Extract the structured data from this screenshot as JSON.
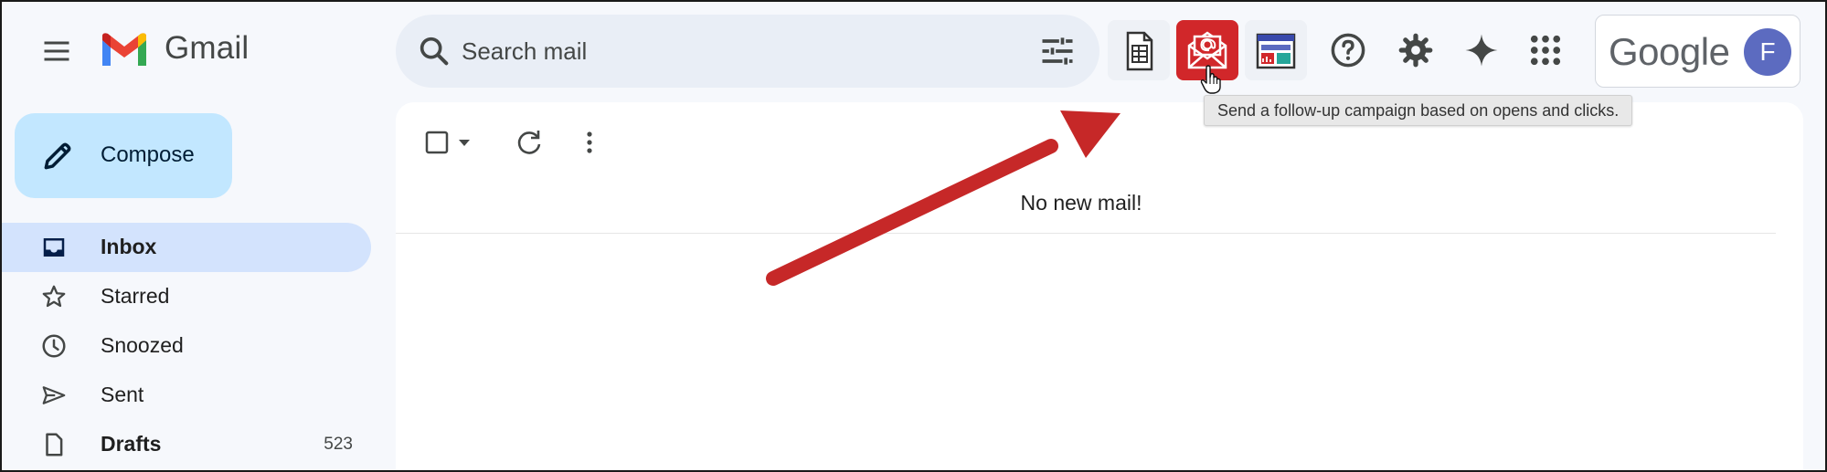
{
  "app": {
    "name": "Gmail"
  },
  "search": {
    "placeholder": "Search mail"
  },
  "header_tools": [
    {
      "name": "spreadsheet-addon-icon"
    },
    {
      "name": "follow-up-campaign-icon"
    },
    {
      "name": "dashboard-addon-icon"
    },
    {
      "name": "help-icon"
    },
    {
      "name": "settings-gear-icon"
    },
    {
      "name": "gemini-spark-icon"
    },
    {
      "name": "apps-grid-icon"
    }
  ],
  "account": {
    "brand": "Google",
    "avatar_letter": "F"
  },
  "tooltip": {
    "text": "Send a follow-up campaign based on opens and clicks."
  },
  "compose": {
    "label": "Compose"
  },
  "nav": [
    {
      "label": "Inbox",
      "icon": "inbox-icon",
      "active": true,
      "bold": true,
      "count": ""
    },
    {
      "label": "Starred",
      "icon": "star-icon",
      "active": false,
      "bold": false,
      "count": ""
    },
    {
      "label": "Snoozed",
      "icon": "clock-icon",
      "active": false,
      "bold": false,
      "count": ""
    },
    {
      "label": "Sent",
      "icon": "send-icon",
      "active": false,
      "bold": false,
      "count": ""
    },
    {
      "label": "Drafts",
      "icon": "draft-icon",
      "active": false,
      "bold": true,
      "count": "523"
    }
  ],
  "main": {
    "empty_message": "No new mail!"
  },
  "colors": {
    "accent_red": "#d1272a",
    "annotation_arrow": "#c62828",
    "compose_bg": "#c2e7ff",
    "active_nav_bg": "#d3e3fd",
    "avatar_bg": "#5c6bc0"
  }
}
